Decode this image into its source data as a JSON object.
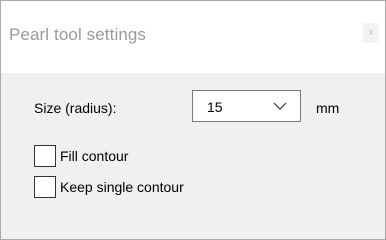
{
  "window": {
    "title": "Pearl tool settings",
    "close_glyph": "x"
  },
  "size": {
    "label": "Size (radius):",
    "value": "15",
    "unit": "mm"
  },
  "options": {
    "fill_contour": {
      "label": "Fill contour",
      "checked": false
    },
    "keep_single_contour": {
      "label": "Keep single contour",
      "checked": false
    }
  },
  "icons": {
    "dropdown": "chevron-down-icon",
    "close": "close-icon"
  },
  "colors": {
    "title_text": "#9a9a9a",
    "dialog_background": "#f0f0f0",
    "titlebar_background": "#ffffff"
  }
}
